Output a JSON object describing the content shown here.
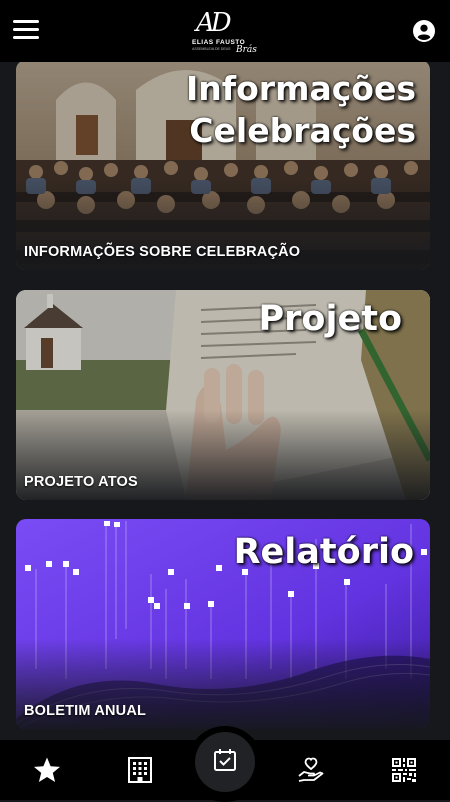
{
  "header": {
    "logo": {
      "monogram": "AD",
      "name": "ELIAS FAUSTO",
      "tagline": "ASSEMBLEIA DE DEUS",
      "script": "Brás"
    },
    "menu_icon": "hamburger-menu-icon",
    "account_icon": "user-circle-icon"
  },
  "cards": [
    {
      "title_lines": [
        "Informações",
        "Celebrações"
      ],
      "label": "INFORMAÇÕES SOBRE CELEBRAÇÃO",
      "image": "church-congregation-photo"
    },
    {
      "title_lines": [
        "Projeto"
      ],
      "label": "PROJETO ATOS",
      "image": "open-book-church-photo"
    },
    {
      "title_lines": [
        "Relatório"
      ],
      "label": "BOLETIM ANUAL",
      "image": "purple-data-chart-graphic"
    }
  ],
  "bottom_nav": [
    {
      "name": "favorites",
      "icon": "star-icon"
    },
    {
      "name": "building",
      "icon": "building-icon"
    },
    {
      "name": "calendar",
      "icon": "calendar-check-icon",
      "active": true
    },
    {
      "name": "donation",
      "icon": "hand-heart-icon"
    },
    {
      "name": "qr-code",
      "icon": "qr-code-icon"
    }
  ],
  "colors": {
    "background": "#16181c",
    "bars": "#000000",
    "report_purple": "#6b3cf0"
  }
}
